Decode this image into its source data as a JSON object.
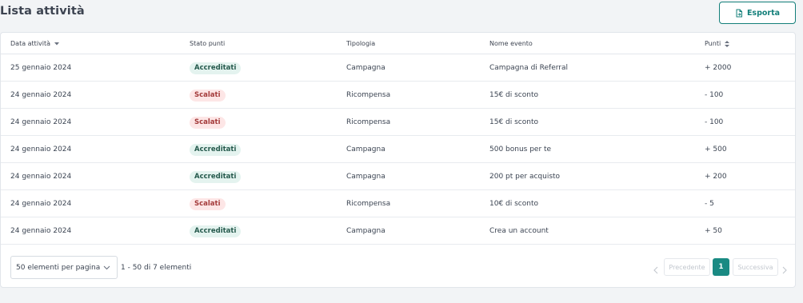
{
  "header": {
    "title": "Lista attività",
    "export_label": "Esporta"
  },
  "table": {
    "columns": {
      "date": "Data attività",
      "status": "Stato punti",
      "type": "Tipologia",
      "event": "Nome evento",
      "points": "Punti"
    },
    "rows": [
      {
        "date": "25 gennaio 2024",
        "status": "Accreditati",
        "status_kind": "credited",
        "type": "Campagna",
        "event": "Campagna di Referral",
        "points": "+ 2000"
      },
      {
        "date": "24 gennaio 2024",
        "status": "Scalati",
        "status_kind": "deducted",
        "type": "Ricompensa",
        "event": "15€ di sconto",
        "points": "- 100"
      },
      {
        "date": "24 gennaio 2024",
        "status": "Scalati",
        "status_kind": "deducted",
        "type": "Ricompensa",
        "event": "15€ di sconto",
        "points": "- 100"
      },
      {
        "date": "24 gennaio 2024",
        "status": "Accreditati",
        "status_kind": "credited",
        "type": "Campagna",
        "event": "500 bonus per te",
        "points": "+ 500"
      },
      {
        "date": "24 gennaio 2024",
        "status": "Accreditati",
        "status_kind": "credited",
        "type": "Campagna",
        "event": "200 pt per acquisto",
        "points": "+ 200"
      },
      {
        "date": "24 gennaio 2024",
        "status": "Scalati",
        "status_kind": "deducted",
        "type": "Ricompensa",
        "event": "10€ di sconto",
        "points": "- 5"
      },
      {
        "date": "24 gennaio 2024",
        "status": "Accreditati",
        "status_kind": "credited",
        "type": "Campagna",
        "event": "Crea un account",
        "points": "+ 50"
      }
    ]
  },
  "footer": {
    "page_size_label": "50 elementi per pagina",
    "range_label": "1 - 50 di 7 elementi",
    "prev_label": "Precedente",
    "current_page": "1",
    "next_label": "Successiva"
  },
  "colors": {
    "accent": "#137f7a",
    "credited_bg": "#e4f3ef",
    "credited_text": "#265a4d",
    "deducted_bg": "#fde6e6",
    "deducted_text": "#a33a3a"
  },
  "icons": {
    "export": "file-export-icon",
    "sort_date": "caret-down-icon",
    "sort_points": "sort-updown-icon",
    "select_chevron": "chevron-down-icon",
    "prev": "chevron-left-icon",
    "next": "chevron-right-icon"
  }
}
